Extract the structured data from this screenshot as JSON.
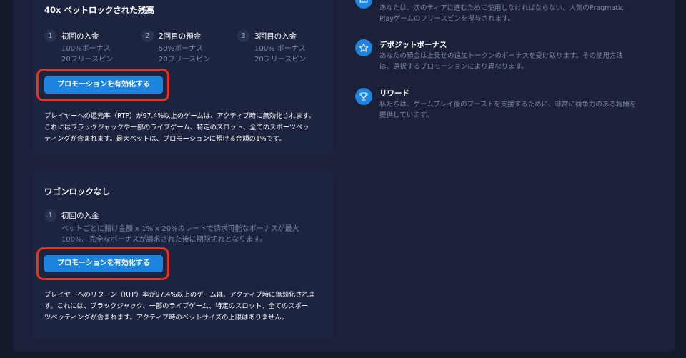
{
  "promotions": [
    {
      "title": "40x ベットロックされた残高",
      "steps": [
        {
          "num": "1",
          "title": "初回の入金",
          "lines": [
            "100%ボーナス",
            "20フリースピン"
          ]
        },
        {
          "num": "2",
          "title": "2回目の預金",
          "lines": [
            "50%ボーナス",
            "20フリースピン"
          ]
        },
        {
          "num": "3",
          "title": "3回目の入金",
          "lines": [
            "100% ボーナス",
            "20フリースピン"
          ]
        }
      ],
      "button_label": "プロモーションを有効化する",
      "description_lines": [
        "プレイヤーへの還元率（RTP）が97.4%以上のゲームは、アクティブ時に無効化されます。",
        "これにはブラックジャックや一部のライブゲーム、特定のスロット、全てのスポーツベッ",
        "ティングが含まれます。最大ベットは、プロモーションに預ける金額の1%です。"
      ]
    },
    {
      "title": "ワゴンロックなし",
      "steps": [
        {
          "num": "1",
          "title": "初回の入金",
          "lines": [
            "ベットごとに賭け金額 x 1% x 20%のレートで請求可能なボーナスが最大",
            "100%。完全なボーナスが請求された後に期限切れとなります。"
          ]
        }
      ],
      "button_label": "プロモーションを有効化する",
      "description_lines": [
        "プレイヤーへのリターン（RTP）率が97.4%以上のゲームは、アクティブ時に無効化されま",
        "す。これには、ブラックジャック、一部のライブゲーム、特定のスロット、全てのスポー",
        "ツベッティングが含まれます。アクティブ時のベットサイズの上限はありません。"
      ]
    }
  ],
  "features": [
    {
      "icon": "crown-icon",
      "title": "",
      "description_lines": [
        "あなたは、次のティアに進むために使用しなければならない、人気のPragmatic",
        "Playゲームのフリースピンを授与されます。"
      ]
    },
    {
      "icon": "star-icon",
      "title": "デポジットボーナス",
      "description_lines": [
        "あなたの預金は上乗せの追加トークンのボーナスを受け取ります。その使用方法",
        "は、選択するプロモーションにより異なります。"
      ]
    },
    {
      "icon": "trophy-icon",
      "title": "リワード",
      "description_lines": [
        "私たちは、ゲームプレイ後のブーストを支援するために、非常に競争力のある報酬を",
        "提供しています。"
      ]
    }
  ],
  "colors": {
    "background": "#141a2c",
    "panel": "#1a2138",
    "card": "#1c2440",
    "accent": "#1d84e0",
    "highlight": "#e8321e",
    "muted_text": "#7f88a3"
  }
}
